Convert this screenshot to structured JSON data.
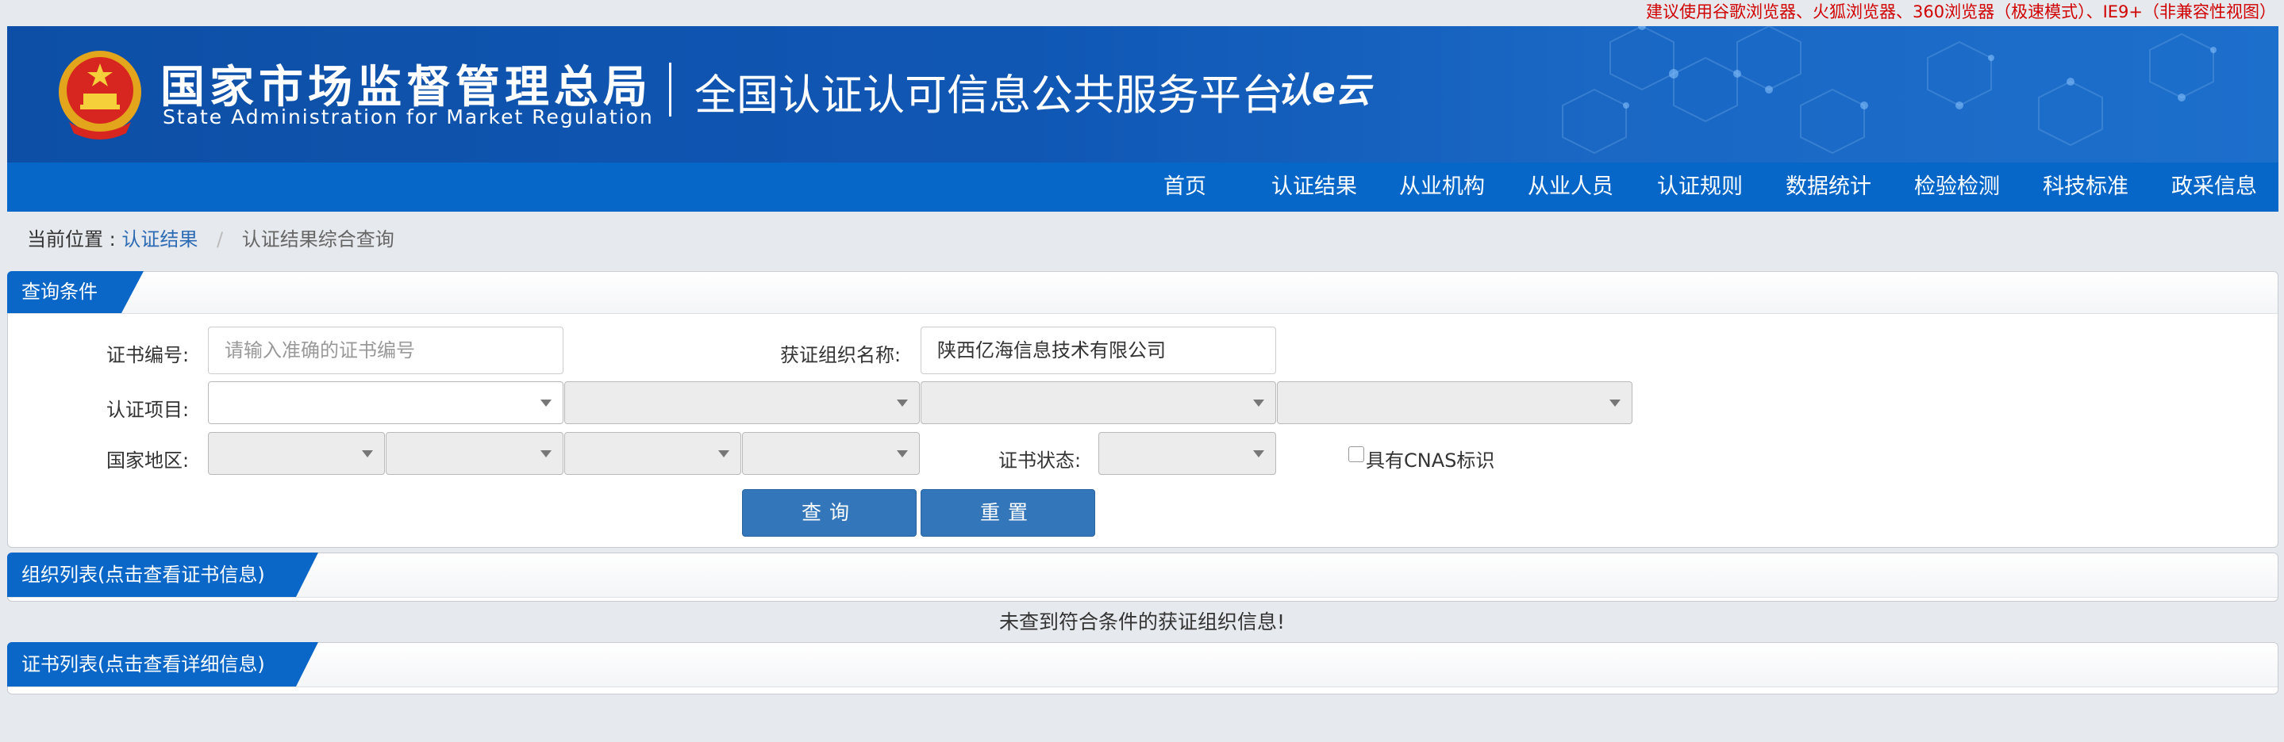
{
  "browser_notice": "建议使用谷歌浏览器、火狐浏览器、360浏览器（极速模式）、IE9+（非兼容性视图）",
  "header": {
    "org_name_cn": "国家市场监督管理总局",
    "org_name_en": "State Administration for Market Regulation",
    "platform_title": "全国认证认可信息公共服务平台",
    "platform_logo_text": "认e云"
  },
  "nav": {
    "items": [
      {
        "label": "首页"
      },
      {
        "label": "认证结果"
      },
      {
        "label": "从业机构"
      },
      {
        "label": "从业人员"
      },
      {
        "label": "认证规则"
      },
      {
        "label": "数据统计"
      },
      {
        "label": "检验检测"
      },
      {
        "label": "科技标准"
      },
      {
        "label": "政采信息"
      }
    ]
  },
  "breadcrumb": {
    "prefix": "当前位置 :",
    "link": "认证结果",
    "separator": "/",
    "current": "认证结果综合查询"
  },
  "query_panel": {
    "title": "查询条件",
    "cert_no_label": "证书编号:",
    "cert_no_placeholder": "请输入准确的证书编号",
    "cert_no_value": "",
    "org_name_label": "获证组织名称:",
    "org_name_value": "陕西亿海信息技术有限公司",
    "cert_project_label": "认证项目:",
    "region_label": "国家地区:",
    "cert_status_label": "证书状态:",
    "cnas_label": "具有CNAS标识",
    "cnas_checked": false,
    "search_button": "查询",
    "reset_button": "重置"
  },
  "org_list_panel": {
    "title": "组织列表(点击查看证书信息)",
    "empty_message": "未查到符合条件的获证组织信息!"
  },
  "cert_list_panel": {
    "title": "证书列表(点击查看详细信息)"
  },
  "colors": {
    "banner_blue": "#1057b4",
    "nav_blue": "#0767c8",
    "button_blue": "#3376ba",
    "notice_red": "#d00000",
    "link_blue": "#2d6bb5"
  }
}
